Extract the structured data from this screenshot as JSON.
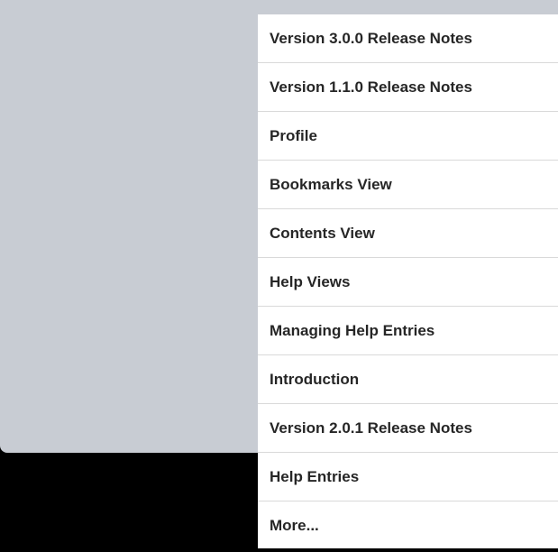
{
  "help_menu": {
    "items": [
      "Version 3.0.0 Release Notes",
      "Version 1.1.0 Release Notes",
      "Profile",
      "Bookmarks View",
      "Contents View",
      "Help Views",
      "Managing Help Entries",
      "Introduction",
      "Version 2.0.1 Release Notes",
      "Help Entries",
      "More..."
    ]
  },
  "colors": {
    "backdrop": "#c8ccd3",
    "menu_background": "#ffffff",
    "separator": "#d9d9d9",
    "text": "#262626",
    "outer": "#000000"
  }
}
